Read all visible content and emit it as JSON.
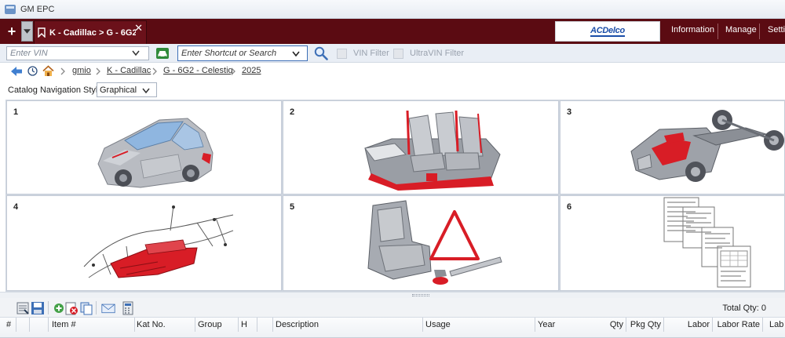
{
  "window": {
    "title": "GM EPC"
  },
  "tab_bar": {
    "new_tab_glyph": "+",
    "active_tab": {
      "label": "K - Cadillac > G - 6G2 - ...",
      "close_glyph": "✕"
    },
    "brand": "ACDelco",
    "menu": [
      "Information",
      "Manage",
      "Setti"
    ]
  },
  "search_bar": {
    "vin_placeholder": "Enter VIN",
    "shortcut_placeholder": "Enter Shortcut or Search",
    "vin_filter_label": "VIN Filter",
    "ultravin_filter_label": "UltraVIN Filter"
  },
  "breadcrumb": {
    "items": [
      "gmio",
      "K - Cadillac",
      "G - 6G2 - Celestiq",
      "2025"
    ]
  },
  "catalog_nav": {
    "label": "Catalog Navigation Style:",
    "selected": "Graphical"
  },
  "tiles": [
    {
      "number": "1",
      "icon": "vehicle-body-illustration"
    },
    {
      "number": "2",
      "icon": "seats-interior-illustration"
    },
    {
      "number": "3",
      "icon": "chassis-drivetrain-illustration"
    },
    {
      "number": "4",
      "icon": "wiring-harness-illustration"
    },
    {
      "number": "5",
      "icon": "seat-frame-warning-triangle-illustration"
    },
    {
      "number": "6",
      "icon": "documents-labels-illustration"
    }
  ],
  "bottom_toolbar": {
    "total_qty": "Total Qty: 0"
  },
  "table": {
    "columns": [
      "#",
      "",
      "",
      "Item #",
      "Kat No.",
      "Group",
      "H",
      "",
      "Description",
      "Usage",
      "Year",
      "Qty",
      "Pkg Qty",
      "Labor",
      "Labor Rate",
      "Lab"
    ]
  },
  "colors": {
    "brand_bar": "#5b0b12",
    "accent_red": "#d81d26",
    "link_blue": "#3d6fb6"
  }
}
